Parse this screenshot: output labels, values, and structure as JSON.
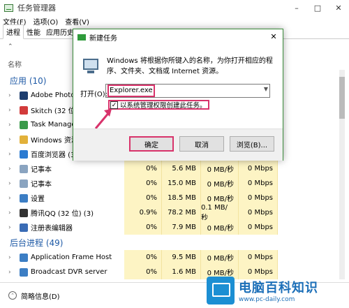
{
  "taskmgr": {
    "title": "任务管理器",
    "menu": [
      "文件(F)",
      "选项(O)",
      "查看(V)"
    ],
    "tabs": [
      "进程",
      "性能",
      "应用历史记"
    ],
    "col_name": "名称",
    "groups": {
      "apps": "应用 (10)",
      "background": "后台进程 (49)"
    },
    "rows": [
      {
        "name": "Adobe Photos",
        "cpu": "",
        "mem": "",
        "disk": "",
        "net": "",
        "color": "#1d3d6e"
      },
      {
        "name": "Skitch (32 位)",
        "cpu": "",
        "mem": "",
        "disk": "",
        "net": "",
        "color": "#d23b3b"
      },
      {
        "name": "Task Manager",
        "cpu": "",
        "mem": "",
        "disk": "",
        "net": "",
        "color": "#3a9a4a"
      },
      {
        "name": "Windows 资源",
        "cpu": "",
        "mem": "",
        "disk": "",
        "net": "",
        "color": "#e2b13a"
      },
      {
        "name": "百度浏览器 (32",
        "cpu": "",
        "mem": "",
        "disk": "",
        "net": "",
        "color": "#2b7bd1"
      },
      {
        "name": "记事本",
        "cpu": "0%",
        "mem": "5.6 MB",
        "disk": "0 MB/秒",
        "net": "0 Mbps",
        "color": "#8aa4c0"
      },
      {
        "name": "记事本",
        "cpu": "0%",
        "mem": "15.0 MB",
        "disk": "0 MB/秒",
        "net": "0 Mbps",
        "color": "#8aa4c0"
      },
      {
        "name": "设置",
        "cpu": "0%",
        "mem": "18.5 MB",
        "disk": "0 MB/秒",
        "net": "0 Mbps",
        "color": "#3c7ec4"
      },
      {
        "name": "腾讯QQ (32 位) (3)",
        "cpu": "0.9%",
        "mem": "78.2 MB",
        "disk": "0.1 MB/秒",
        "net": "0 Mbps",
        "color": "#333"
      },
      {
        "name": "注册表编辑器",
        "cpu": "0%",
        "mem": "7.9 MB",
        "disk": "0 MB/秒",
        "net": "0 Mbps",
        "color": "#3a6cb5"
      }
    ],
    "bg_rows": [
      {
        "name": "Application Frame Host",
        "cpu": "0%",
        "mem": "9.5 MB",
        "disk": "0 MB/秒",
        "net": "0 Mbps",
        "color": "#3c7ec4"
      },
      {
        "name": "Broadcast DVR server",
        "cpu": "0%",
        "mem": "1.6 MB",
        "disk": "0 MB/秒",
        "net": "0 Mbps",
        "color": "#3c7ec4"
      }
    ],
    "footer": "简略信息(D)"
  },
  "dialog": {
    "title": "新建任务",
    "description": "Windows 将根据你所键入的名称，为你打开相应的程序、文件夹、文档或 Internet 资源。",
    "open_label": "打开(O):",
    "input_value": "Explorer.exe",
    "checkbox_label": "以系统管理权限创建此任务。",
    "checkbox_checked": "✓",
    "ok": "确定",
    "cancel": "取消",
    "browse": "浏览(B)..."
  },
  "watermark": {
    "name": "电脑百科知识",
    "url": "www.pc-daily.com"
  },
  "colors": {
    "accent_pink": "#d8336b",
    "highlight_yellow": "#fdf4c4",
    "group_blue": "#1f5aa6"
  }
}
